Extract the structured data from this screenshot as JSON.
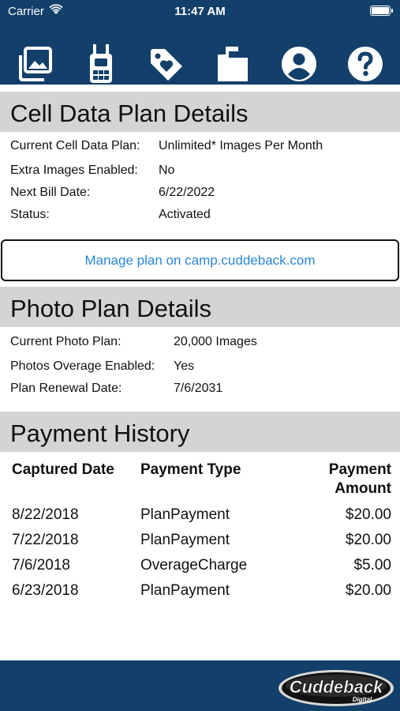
{
  "status_bar": {
    "carrier": "Carrier",
    "time": "11:47 AM"
  },
  "toolbar": {
    "icons": [
      "photos-icon",
      "camera-device-icon",
      "tags-icon",
      "folders-icon",
      "account-icon",
      "help-icon"
    ],
    "background_color": "#13406a"
  },
  "cell_plan": {
    "title": "Cell Data Plan Details",
    "rows": [
      {
        "label": "Current Cell Data Plan:",
        "value": "Unlimited* Images Per Month"
      },
      {
        "label": "Extra Images Enabled:",
        "value": "No"
      },
      {
        "label": "Next Bill Date:",
        "value": "6/22/2022"
      },
      {
        "label": "Status:",
        "value": "Activated"
      }
    ],
    "manage_link": "Manage plan on camp.cuddeback.com"
  },
  "photo_plan": {
    "title": "Photo Plan Details",
    "rows": [
      {
        "label": "Current Photo Plan:",
        "value": "20,000 Images"
      },
      {
        "label": "Photos Overage Enabled:",
        "value": "Yes"
      },
      {
        "label": "Plan Renewal Date:",
        "value": "7/6/2031"
      }
    ]
  },
  "payment_history": {
    "title": "Payment History",
    "headers": {
      "date": "Captured Date",
      "type": "Payment Type",
      "amount_line1": "Payment",
      "amount_line2": "Amount"
    },
    "rows": [
      {
        "date": "8/22/2018",
        "type": "PlanPayment",
        "amount": "$20.00"
      },
      {
        "date": "7/22/2018",
        "type": "PlanPayment",
        "amount": "$20.00"
      },
      {
        "date": "7/6/2018",
        "type": "OverageCharge",
        "amount": "$5.00"
      },
      {
        "date": "6/23/2018",
        "type": "PlanPayment",
        "amount": "$20.00"
      }
    ]
  },
  "footer": {
    "logo_text": "Cuddeback",
    "logo_subtext": "Digital"
  },
  "colors": {
    "header": "#13406a",
    "section": "#d4d4d4",
    "link": "#2a86d9"
  }
}
